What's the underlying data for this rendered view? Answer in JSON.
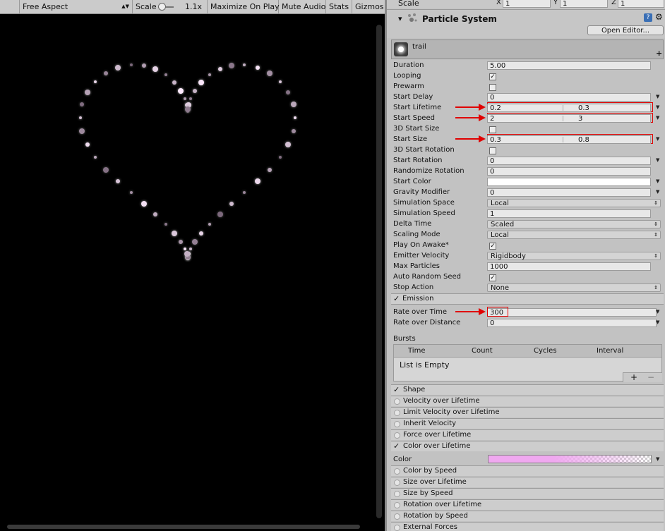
{
  "game_toolbar": {
    "aspect": "Free Aspect",
    "scale_label": "Scale",
    "scale_value": "1.1x",
    "maximize": "Maximize On Play",
    "mute": "Mute Audio",
    "stats": "Stats",
    "gizmos": "Gizmos"
  },
  "transform_scale": {
    "label": "Scale",
    "x_label": "X",
    "x": "1",
    "y_label": "Y",
    "y": "1",
    "z_label": "Z",
    "z": "1"
  },
  "component": {
    "title": "Particle System",
    "open_editor": "Open Editor..."
  },
  "system_name": "trail",
  "main_rows": [
    {
      "label": "Duration",
      "value": "5.00"
    },
    {
      "label": "Looping",
      "checked": "✓"
    },
    {
      "label": "Prewarm",
      "checked": ""
    },
    {
      "label": "Start Delay",
      "value": "0"
    },
    {
      "label": "Start Lifetime",
      "min": "0.2",
      "max": "0.3"
    },
    {
      "label": "Start Speed",
      "min": "2",
      "max": "3"
    },
    {
      "label": "3D Start Size",
      "checked": ""
    },
    {
      "label": "Start Size",
      "min": "0.3",
      "max": "0.8"
    },
    {
      "label": "3D Start Rotation",
      "checked": ""
    },
    {
      "label": "Start Rotation",
      "value": "0"
    },
    {
      "label": "Randomize Rotation",
      "value": "0"
    },
    {
      "label": "Start Color"
    },
    {
      "label": "Gravity Modifier",
      "value": "0"
    },
    {
      "label": "Simulation Space",
      "value": "Local"
    },
    {
      "label": "Simulation Speed",
      "value": "1"
    },
    {
      "label": "Delta Time",
      "value": "Scaled"
    },
    {
      "label": "Scaling Mode",
      "value": "Local"
    },
    {
      "label": "Play On Awake*",
      "checked": "✓"
    },
    {
      "label": "Emitter Velocity",
      "value": "Rigidbody"
    },
    {
      "label": "Max Particles",
      "value": "1000"
    },
    {
      "label": "Auto Random Seed",
      "checked": "✓"
    },
    {
      "label": "Stop Action",
      "value": "None"
    }
  ],
  "emission": {
    "title": "Emission",
    "rate_time_label": "Rate over Time",
    "rate_time": "300",
    "rate_distance_label": "Rate over Distance",
    "rate_distance": "0",
    "bursts_label": "Bursts",
    "columns": [
      "Time",
      "Count",
      "Cycles",
      "Interval"
    ],
    "empty": "List is Empty",
    "add": "+",
    "remove": "−"
  },
  "modules_a": [
    {
      "name": "Shape",
      "on": true
    },
    {
      "name": "Velocity over Lifetime",
      "on": false
    },
    {
      "name": "Limit Velocity over Lifetime",
      "on": false
    },
    {
      "name": "Inherit Velocity",
      "on": false
    },
    {
      "name": "Force over Lifetime",
      "on": false
    },
    {
      "name": "Color over Lifetime",
      "on": true
    }
  ],
  "color_label": "Color",
  "modules_b": [
    {
      "name": "Color by Speed",
      "on": false
    },
    {
      "name": "Size over Lifetime",
      "on": false
    },
    {
      "name": "Size by Speed",
      "on": false
    },
    {
      "name": "Rotation over Lifetime",
      "on": false
    },
    {
      "name": "Rotation by Speed",
      "on": false
    },
    {
      "name": "External Forces",
      "on": false
    }
  ],
  "colors": {
    "highlight": "#e00000",
    "gradient_start": "#f0a8f0",
    "gradient_end": "#ffffff"
  },
  "icons": [
    "dropdown-arrow-icon",
    "checkmark-icon",
    "book-icon",
    "gear-icon",
    "particle-icon",
    "plus-icon",
    "minus-icon"
  ]
}
